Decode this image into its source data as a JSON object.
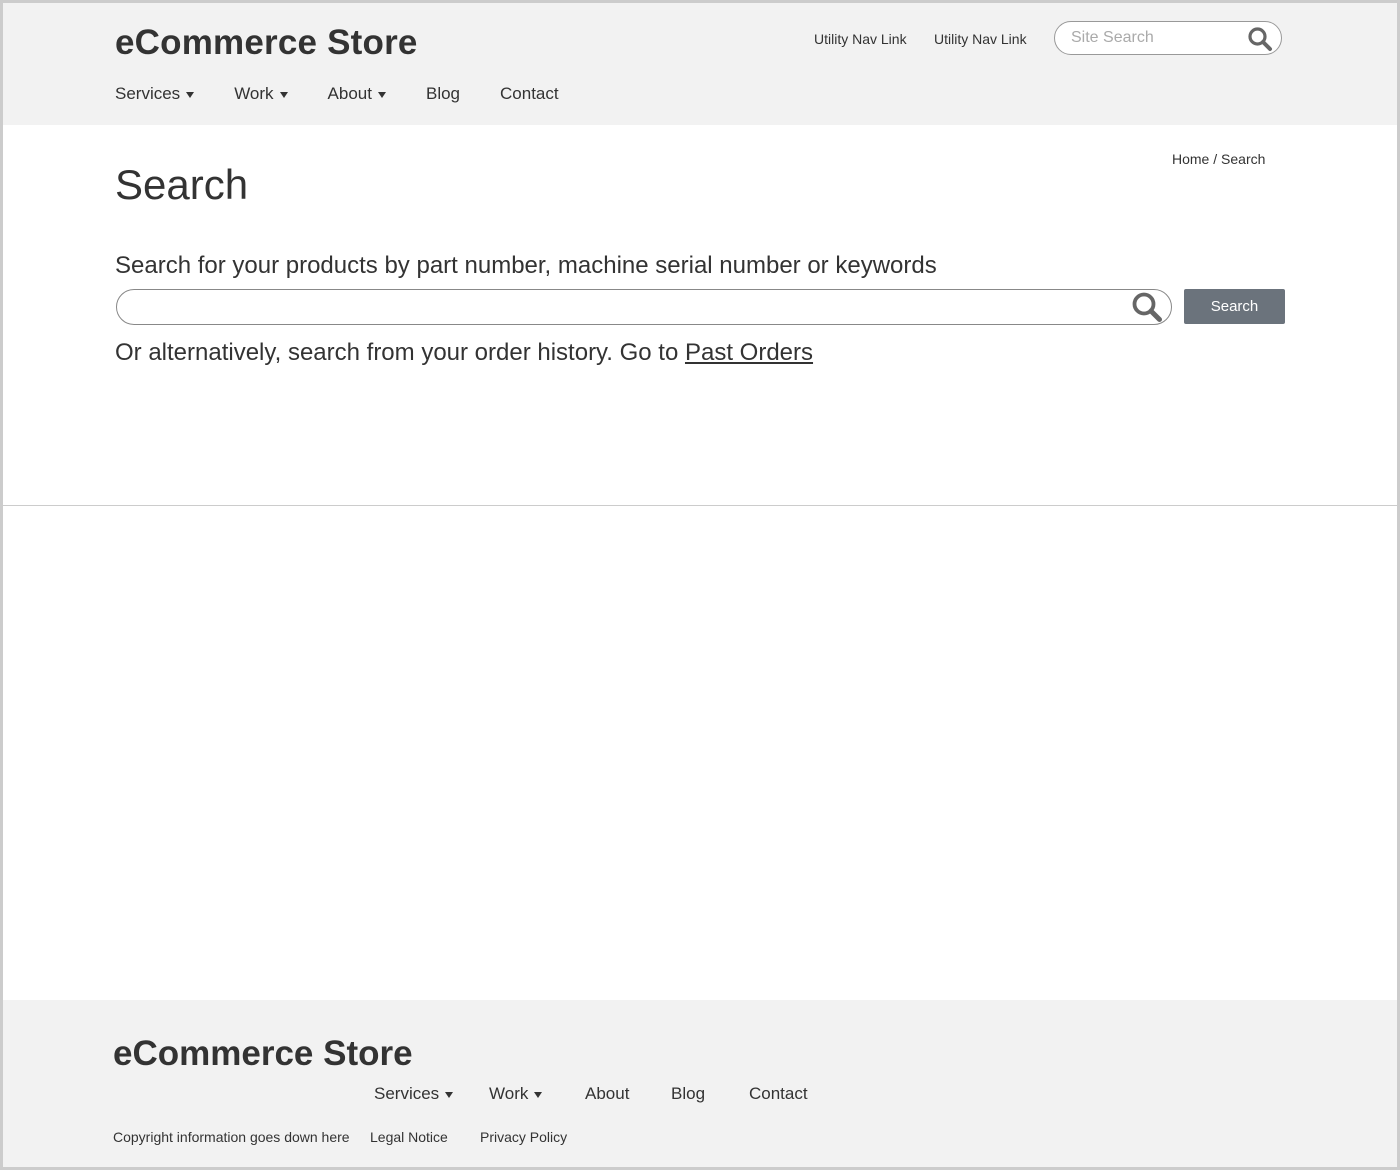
{
  "header": {
    "logo": "eCommerce Store",
    "utility_links": [
      "Utility Nav Link",
      "Utility Nav Link"
    ],
    "site_search": {
      "placeholder": "Site Search",
      "icon": "search-icon"
    },
    "nav": [
      {
        "label": "Services",
        "dropdown": true
      },
      {
        "label": "Work",
        "dropdown": true
      },
      {
        "label": "About",
        "dropdown": true
      },
      {
        "label": "Blog",
        "dropdown": false
      },
      {
        "label": "Contact",
        "dropdown": false
      }
    ]
  },
  "breadcrumb": {
    "home": "Home",
    "separator": "/",
    "current": "Search"
  },
  "main": {
    "title": "Search",
    "intro": "Search for your products by part number, machine serial number or keywords",
    "search_input": {
      "value": "",
      "icon": "search-icon"
    },
    "search_button": "Search",
    "alt_text": "Or alternatively, search from your order history. Go to",
    "alt_link": "Past Orders"
  },
  "footer": {
    "logo": "eCommerce Store",
    "nav": [
      {
        "label": "Services",
        "dropdown": true
      },
      {
        "label": "Work",
        "dropdown": true
      },
      {
        "label": "About",
        "dropdown": false
      },
      {
        "label": "Blog",
        "dropdown": false
      },
      {
        "label": "Contact",
        "dropdown": false
      }
    ],
    "copyright": "Copyright information goes down here",
    "legal": "Legal Notice",
    "privacy": "Privacy Policy"
  },
  "colors": {
    "header_bg": "#f2f2f2",
    "button_bg": "#6b737c",
    "text": "#333333",
    "border": "#cccccc"
  }
}
